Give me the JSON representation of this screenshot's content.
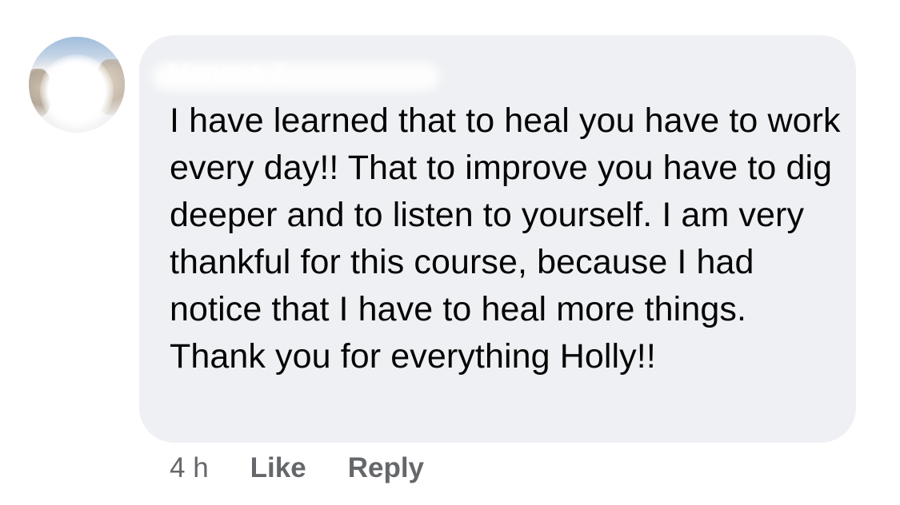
{
  "comment": {
    "author_name": "Mariana Z",
    "text": "I have learned that to heal you have to work every day!! That to improve you have to dig deeper and to listen to yourself. I am very thankful for this course, because I had notice that I have to heal more things. Thank you for everything Holly!!",
    "timestamp": "4 h",
    "like_label": "Like",
    "reply_label": "Reply"
  },
  "colors": {
    "bubble_background": "#eff0f3",
    "text": "#050505",
    "secondary_text": "#65676b"
  }
}
